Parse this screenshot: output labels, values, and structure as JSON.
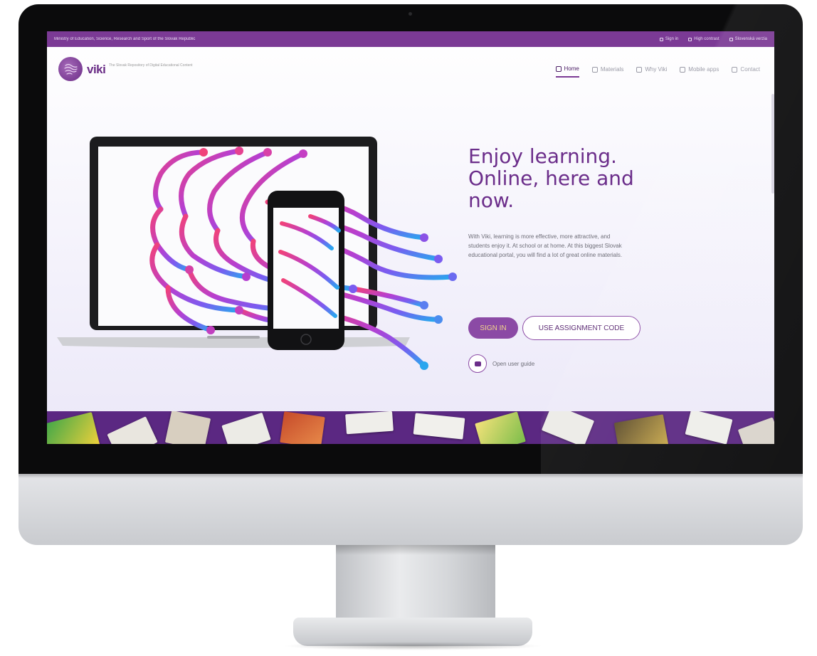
{
  "topbar": {
    "ministry": "Ministry of Education, Science, Research and Sport of the Slovak Republic",
    "links": [
      {
        "label": "Sign in",
        "icon": "user-icon"
      },
      {
        "label": "High contrast",
        "icon": "contrast-icon"
      },
      {
        "label": "Slovenská verzia",
        "icon": "language-icon"
      }
    ]
  },
  "logo": {
    "text": "viki",
    "subtitle": "The Slovak Repository of Digital Educational Content"
  },
  "nav": [
    {
      "label": "Home",
      "icon": "home-icon",
      "active": true
    },
    {
      "label": "Materials",
      "icon": "materials-icon",
      "active": false
    },
    {
      "label": "Why Viki",
      "icon": "why-icon",
      "active": false
    },
    {
      "label": "Mobile apps",
      "icon": "mobile-icon",
      "active": false
    },
    {
      "label": "Contact",
      "icon": "mail-icon",
      "active": false
    }
  ],
  "hero": {
    "headline": [
      "Enjoy learning.",
      "Online, here and",
      "now."
    ],
    "description": "With Viki, learning is more effective, more attractive, and students enjoy it. At school or at home. At this biggest Slovak educational portal, you will find a lot of great online materials.",
    "signin_label": "SIGN IN",
    "code_label": "USE ASSIGNMENT CODE",
    "guide_label": "Open user guide"
  },
  "colors": {
    "brand": "#7b3a95",
    "accent": "#f1d58a"
  }
}
